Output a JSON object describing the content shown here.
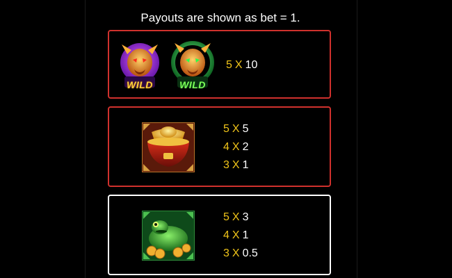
{
  "header": {
    "text": "Payouts are shown as bet = 1."
  },
  "symbols": [
    {
      "icons": [
        "wild-purple-dragon-icon",
        "wild-green-dragon-icon"
      ],
      "wild_label": "WILD",
      "payouts": [
        {
          "count": "5",
          "x": "X",
          "value": "10"
        }
      ]
    },
    {
      "icons": [
        "gold-ingot-bowl-icon"
      ],
      "payouts": [
        {
          "count": "5",
          "x": "X",
          "value": "5"
        },
        {
          "count": "4",
          "x": "X",
          "value": "2"
        },
        {
          "count": "3",
          "x": "X",
          "value": "1"
        }
      ]
    },
    {
      "icons": [
        "jade-toad-icon"
      ],
      "payouts": [
        {
          "count": "5",
          "x": "X",
          "value": "3"
        },
        {
          "count": "4",
          "x": "X",
          "value": "1"
        },
        {
          "count": "3",
          "x": "X",
          "value": "0.5"
        }
      ]
    }
  ],
  "colors": {
    "card_border": "#d0312d",
    "selected_border": "#ffffff",
    "multiplier": "#f0c419"
  }
}
